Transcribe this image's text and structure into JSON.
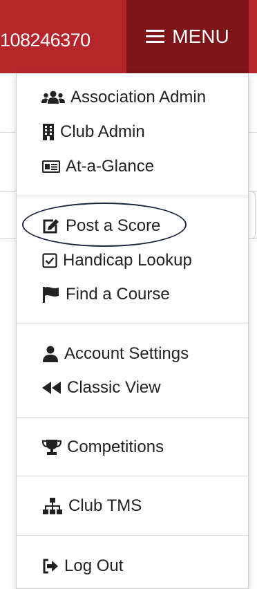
{
  "header": {
    "member_id": "108246370",
    "menu_label": "MENU"
  },
  "menu": {
    "association_admin": "Association Admin",
    "club_admin": "Club Admin",
    "at_a_glance": "At-a-Glance",
    "post_a_score": "Post a Score",
    "handicap_lookup": "Handicap Lookup",
    "find_a_course": "Find a Course",
    "account_settings": "Account Settings",
    "classic_view": "Classic View",
    "competitions": "Competitions",
    "club_tms": "Club TMS",
    "log_out": "Log Out"
  },
  "icons": {
    "menu": "hamburger-icon",
    "association_admin": "users-icon",
    "club_admin": "building-icon",
    "at_a_glance": "id-card-icon",
    "post_a_score": "edit-icon",
    "handicap_lookup": "check-square-icon",
    "find_a_course": "flag-icon",
    "account_settings": "user-icon",
    "classic_view": "backward-icon",
    "competitions": "trophy-icon",
    "club_tms": "sitemap-icon",
    "log_out": "sign-out-icon"
  },
  "colors": {
    "header_bg": "#b5262b",
    "menu_button_bg": "#7c1418",
    "text": "#222222",
    "highlight_oval": "#1d2540"
  }
}
